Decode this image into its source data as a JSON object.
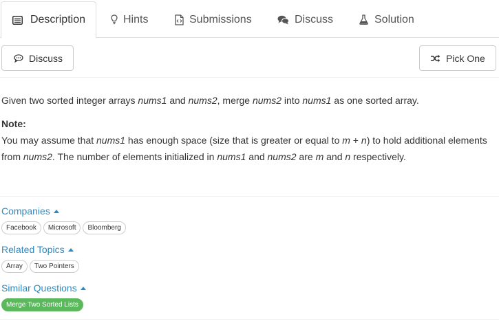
{
  "tabs": [
    {
      "label": "Description",
      "icon": "description-icon",
      "active": true
    },
    {
      "label": "Hints",
      "icon": "lightbulb-icon",
      "active": false
    },
    {
      "label": "Submissions",
      "icon": "code-file-icon",
      "active": false
    },
    {
      "label": "Discuss",
      "icon": "comments-icon",
      "active": false
    },
    {
      "label": "Solution",
      "icon": "flask-icon",
      "active": false
    }
  ],
  "toolbar": {
    "discuss_label": "Discuss",
    "pick_one_label": "Pick One"
  },
  "problem": {
    "line1": {
      "p1": "Given two sorted integer arrays ",
      "v1": "nums1",
      "p2": " and ",
      "v2": "nums2",
      "p3": ", merge ",
      "v3": "nums2",
      "p4": " into ",
      "v4": "nums1",
      "p5": " as one sorted array."
    },
    "note_label": "Note:",
    "note1": {
      "p1": "You may assume that ",
      "v1": "nums1",
      "p2": " has enough space (size that is greater or equal to ",
      "v2": "m",
      "p3": " + ",
      "v3": "n",
      "p4": ") to hold additional elements"
    },
    "note2": {
      "p1": "from ",
      "v1": "nums2",
      "p2": ". The number of elements initialized in ",
      "v2": "nums1",
      "p3": " and ",
      "v3": "nums2",
      "p4": " are ",
      "v4": "m",
      "p5": " and ",
      "v5": "n",
      "p6": " respectively."
    }
  },
  "companies": {
    "title": "Companies",
    "tags": [
      "Facebook",
      "Microsoft",
      "Bloomberg"
    ]
  },
  "related_topics": {
    "title": "Related Topics",
    "tags": [
      "Array",
      "Two Pointers"
    ]
  },
  "similar_questions": {
    "title": "Similar Questions",
    "tags": [
      "Merge Two Sorted Lists"
    ]
  },
  "colors": {
    "link": "#2b8bc4",
    "success_tag": "#5cb85c",
    "border": "#dddddd"
  }
}
